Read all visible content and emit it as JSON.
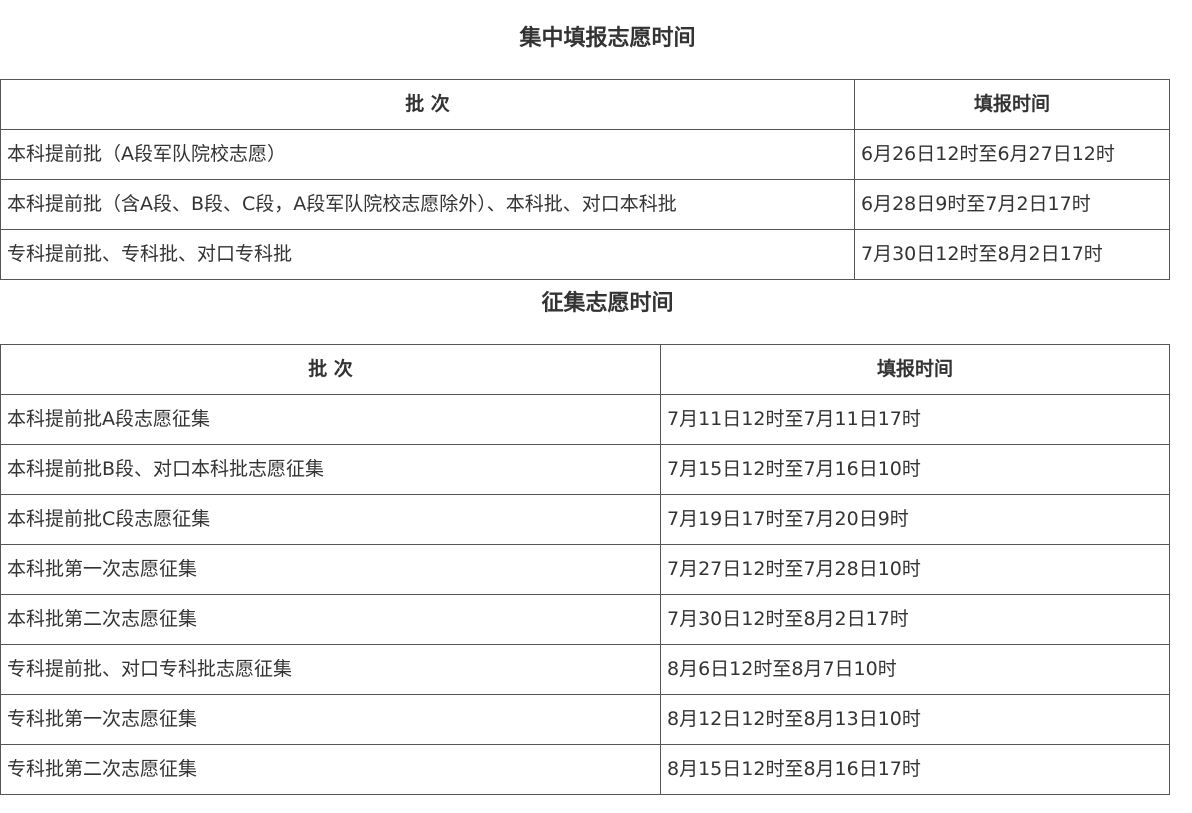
{
  "sections": [
    {
      "title": "集中填报志愿时间",
      "headers": [
        "批 次",
        "填报时间"
      ],
      "rows": [
        [
          "本科提前批（A段军队院校志愿）",
          "6月26日12时至6月27日12时"
        ],
        [
          "本科提前批（含A段、B段、C段，A段军队院校志愿除外）、本科批、对口本科批",
          "6月28日9时至7月2日17时"
        ],
        [
          "专科提前批、专科批、对口专科批",
          "7月30日12时至8月2日17时"
        ]
      ]
    },
    {
      "title": "征集志愿时间",
      "headers": [
        "批 次",
        "填报时间"
      ],
      "rows": [
        [
          "本科提前批A段志愿征集",
          "7月11日12时至7月11日17时"
        ],
        [
          "本科提前批B段、对口本科批志愿征集",
          "7月15日12时至7月16日10时"
        ],
        [
          "本科提前批C段志愿征集",
          "7月19日17时至7月20日9时"
        ],
        [
          "本科批第一次志愿征集",
          "7月27日12时至7月28日10时"
        ],
        [
          "本科批第二次志愿征集",
          "7月30日12时至8月2日17时"
        ],
        [
          "专科提前批、对口专科批志愿征集",
          "8月6日12时至8月7日10时"
        ],
        [
          "专科批第一次志愿征集",
          "8月12日12时至8月13日10时"
        ],
        [
          "专科批第二次志愿征集",
          "8月15日12时至8月16日17时"
        ]
      ]
    }
  ]
}
